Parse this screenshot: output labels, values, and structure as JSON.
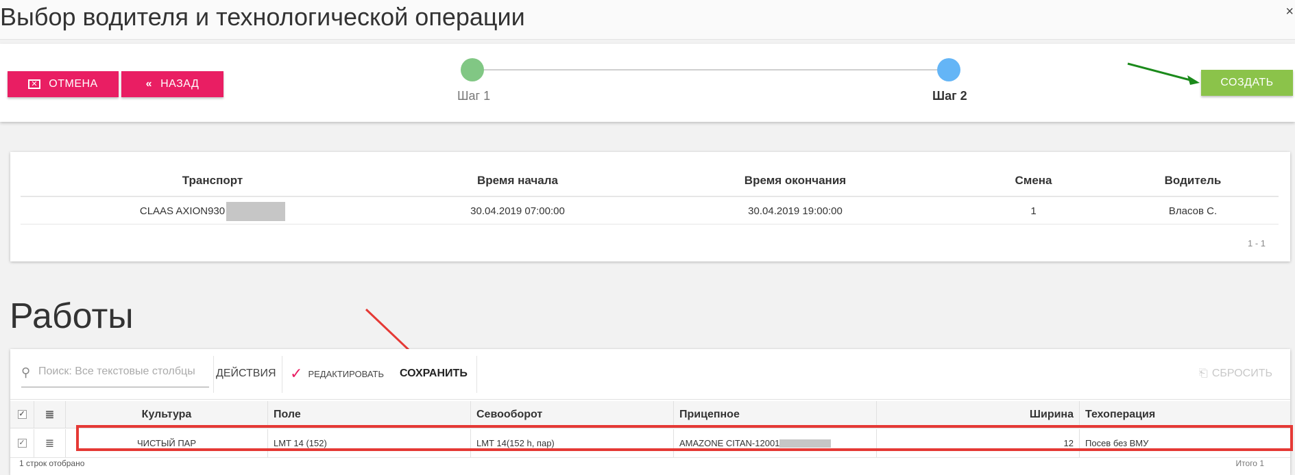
{
  "window": {
    "title": "Выбор водителя и технологической операции",
    "close_label": "×"
  },
  "stepper": {
    "cancel_label": "ОТМЕНА",
    "back_label": "НАЗАД",
    "create_label": "СОЗДАТЬ",
    "steps": [
      {
        "label": "Шаг 1",
        "color": "#81c784"
      },
      {
        "label": "Шаг 2",
        "color": "#64b5f6",
        "active": true
      }
    ]
  },
  "transport_table": {
    "columns": [
      "Транспорт",
      "Время начала",
      "Время окончания",
      "Смена",
      "Водитель"
    ],
    "rows": [
      {
        "transport": "CLAAS AXION930",
        "start": "30.04.2019 07:00:00",
        "end": "30.04.2019 19:00:00",
        "shift": "1",
        "driver": "Власов С."
      }
    ],
    "pager": "1 - 1"
  },
  "works": {
    "title": "Работы",
    "search_placeholder": "Поиск: Все текстовые столбцы",
    "actions_label": "ДЕЙСТВИЯ",
    "edit_label": "РЕДАКТИРОВАТЬ",
    "save_label": "СОХРАНИТЬ",
    "reset_label": "СБРОСИТЬ",
    "columns": [
      "Культура",
      "Поле",
      "Севооборот",
      "Прицепное",
      "Ширина",
      "Техоперация"
    ],
    "rows": [
      {
        "culture": "ЧИСТЫЙ ПАР",
        "field": "LMT 14 (152)",
        "rotation": "LMT 14(152 h, пар)",
        "trailer": "AMAZONE CITAN-12001",
        "width": "12",
        "operation": "Посев без ВМУ"
      }
    ],
    "footer_left": "1 строк отобрано",
    "footer_right": "Итого 1"
  },
  "colors": {
    "primary_pink": "#e91e63",
    "create_green": "#8bc34a",
    "highlight_red": "#e53935",
    "arrow_green": "#1b8a1b"
  }
}
